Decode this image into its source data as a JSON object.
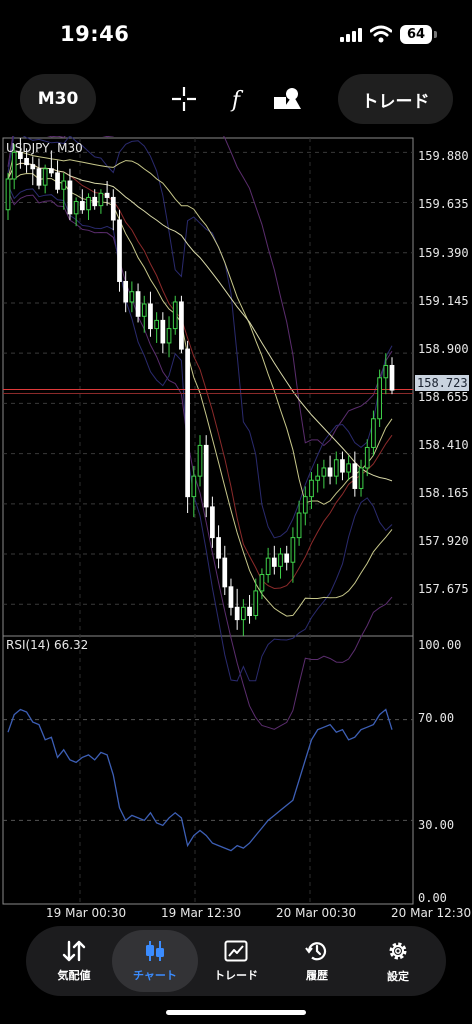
{
  "status_bar": {
    "time": "19:46",
    "battery": "64"
  },
  "toolbar": {
    "timeframe": "M30",
    "trade_label": "トレード",
    "icons": [
      "crosshair-icon",
      "function-icon",
      "objects-icon"
    ]
  },
  "chart": {
    "title": "USDJPY, M30",
    "price_labels": [
      "159.880",
      "159.635",
      "159.390",
      "159.145",
      "158.900",
      "158.655",
      "158.410",
      "158.165",
      "157.920",
      "157.675"
    ],
    "current_price": "158.723",
    "time_labels": [
      "19 Mar 00:30",
      "19 Mar 12:30",
      "20 Mar 00:30",
      "20 Mar 12:30"
    ],
    "rsi_title": "RSI(14) 66.32",
    "rsi_labels": [
      "100.00",
      "70.00",
      "30.00",
      "0.00"
    ],
    "colors": {
      "bull": "#3fd14a",
      "bear": "#ffffff",
      "bid_line": "#e03a3a",
      "rsi_line": "#3d5fb5"
    }
  },
  "chart_data": {
    "type": "candlestick",
    "symbol": "USDJPY",
    "timeframe": "M30",
    "ylim": [
      157.52,
      159.95
    ],
    "ohlc": [
      [
        159.6,
        159.78,
        159.55,
        159.75
      ],
      [
        159.75,
        159.92,
        159.7,
        159.88
      ],
      [
        159.88,
        159.95,
        159.8,
        159.85
      ],
      [
        159.85,
        159.9,
        159.78,
        159.82
      ],
      [
        159.82,
        159.86,
        159.72,
        159.8
      ],
      [
        159.8,
        159.85,
        159.7,
        159.72
      ],
      [
        159.72,
        159.82,
        159.68,
        159.8
      ],
      [
        159.8,
        159.88,
        159.76,
        159.78
      ],
      [
        159.78,
        159.84,
        159.68,
        159.7
      ],
      [
        159.7,
        159.78,
        159.6,
        159.74
      ],
      [
        159.74,
        159.8,
        159.55,
        159.58
      ],
      [
        159.58,
        159.66,
        159.52,
        159.64
      ],
      [
        159.64,
        159.7,
        159.58,
        159.6
      ],
      [
        159.6,
        159.68,
        159.55,
        159.66
      ],
      [
        159.66,
        159.7,
        159.6,
        159.62
      ],
      [
        159.62,
        159.7,
        159.58,
        159.68
      ],
      [
        159.68,
        159.74,
        159.62,
        159.66
      ],
      [
        159.66,
        159.7,
        159.5,
        159.55
      ],
      [
        159.55,
        159.6,
        159.2,
        159.25
      ],
      [
        159.25,
        159.3,
        159.1,
        159.15
      ],
      [
        159.15,
        159.25,
        159.1,
        159.2
      ],
      [
        159.2,
        159.24,
        159.05,
        159.08
      ],
      [
        159.08,
        159.18,
        159.0,
        159.14
      ],
      [
        159.14,
        159.2,
        158.98,
        159.02
      ],
      [
        159.02,
        159.1,
        158.95,
        159.06
      ],
      [
        159.06,
        159.1,
        158.9,
        158.95
      ],
      [
        158.95,
        159.08,
        158.88,
        159.02
      ],
      [
        159.02,
        159.18,
        158.99,
        159.15
      ],
      [
        159.15,
        159.18,
        158.9,
        158.92
      ],
      [
        158.92,
        158.96,
        158.12,
        158.2
      ],
      [
        158.2,
        158.35,
        158.1,
        158.3
      ],
      [
        158.3,
        158.5,
        158.25,
        158.45
      ],
      [
        158.45,
        158.5,
        158.1,
        158.15
      ],
      [
        158.15,
        158.2,
        157.95,
        158.0
      ],
      [
        158.0,
        158.06,
        157.85,
        157.9
      ],
      [
        157.9,
        157.96,
        157.72,
        157.76
      ],
      [
        157.76,
        157.8,
        157.62,
        157.66
      ],
      [
        157.66,
        157.75,
        157.55,
        157.6
      ],
      [
        157.6,
        157.7,
        157.52,
        157.66
      ],
      [
        157.66,
        157.72,
        157.58,
        157.62
      ],
      [
        157.62,
        157.8,
        157.6,
        157.74
      ],
      [
        157.74,
        157.85,
        157.7,
        157.82
      ],
      [
        157.82,
        157.95,
        157.78,
        157.9
      ],
      [
        157.9,
        157.96,
        157.82,
        157.86
      ],
      [
        157.86,
        157.95,
        157.8,
        157.92
      ],
      [
        157.92,
        157.96,
        157.84,
        157.88
      ],
      [
        157.88,
        158.05,
        157.78,
        158.0
      ],
      [
        158.0,
        158.18,
        157.96,
        158.12
      ],
      [
        158.12,
        158.25,
        158.06,
        158.2
      ],
      [
        158.2,
        158.32,
        158.14,
        158.28
      ],
      [
        158.28,
        158.36,
        158.22,
        158.3
      ],
      [
        158.3,
        158.38,
        158.24,
        158.34
      ],
      [
        158.34,
        158.4,
        158.26,
        158.3
      ],
      [
        158.3,
        158.42,
        158.26,
        158.38
      ],
      [
        158.38,
        158.42,
        158.28,
        158.32
      ],
      [
        158.32,
        158.4,
        158.28,
        158.36
      ],
      [
        158.36,
        158.42,
        158.2,
        158.24
      ],
      [
        158.24,
        158.38,
        158.2,
        158.34
      ],
      [
        158.34,
        158.48,
        158.3,
        158.44
      ],
      [
        158.44,
        158.62,
        158.4,
        158.58
      ],
      [
        158.58,
        158.82,
        158.54,
        158.78
      ],
      [
        158.78,
        158.9,
        158.7,
        158.84
      ],
      [
        158.84,
        158.88,
        158.7,
        158.72
      ]
    ],
    "current_price": 158.723,
    "rsi": {
      "period": 14,
      "ylim": [
        0,
        100
      ],
      "last": 66.32,
      "values": [
        65,
        72,
        74,
        73,
        69,
        68,
        62,
        63,
        55,
        58,
        54,
        53,
        55,
        56,
        54,
        57,
        56,
        48,
        35,
        30,
        32,
        31,
        30,
        33,
        29,
        28,
        31,
        33,
        31,
        20,
        24,
        26,
        24,
        21,
        20,
        19,
        18,
        20,
        19,
        21,
        24,
        27,
        30,
        32,
        34,
        36,
        38,
        46,
        54,
        62,
        66,
        67,
        68,
        65,
        66,
        62,
        63,
        66,
        67,
        68,
        72,
        74,
        66
      ]
    }
  }
}
